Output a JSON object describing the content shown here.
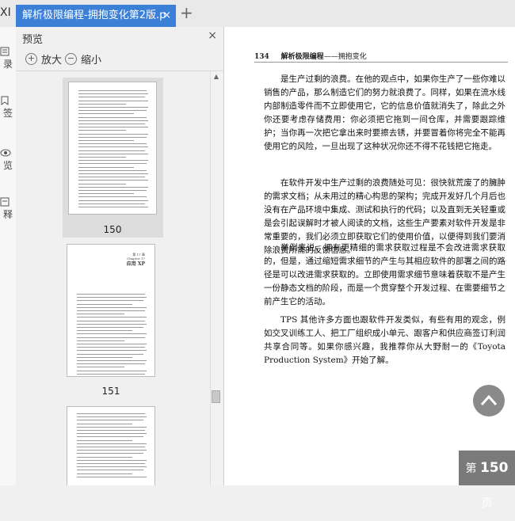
{
  "tabbar": {
    "left_fragment": "XI",
    "active_tab_title": "解析极限编程-拥抱变化第2版.p",
    "close_glyph": "×",
    "new_tab_glyph": "+"
  },
  "left_nav": {
    "items": [
      {
        "label": "录",
        "icon": "list-icon"
      },
      {
        "label": "签",
        "icon": "bookmark-icon"
      },
      {
        "label": "览",
        "icon": "eye-icon"
      },
      {
        "label": "释",
        "icon": "annotation-icon"
      }
    ]
  },
  "preview_panel": {
    "title": "预览",
    "close_glyph": "×",
    "zoom_in_label": "放大",
    "zoom_out_label": "缩小",
    "thumbnails": [
      {
        "page": "150",
        "selected": true
      },
      {
        "page": "151",
        "selected": false
      }
    ],
    "chapter_label_top": "第 17 章",
    "chapter_label_sub": "Chapter 17",
    "chapter_title": "应用 XP"
  },
  "document": {
    "page_number": "134",
    "header_title": "解析极限编程",
    "header_subtitle": "——拥抱变化",
    "paragraphs": [
      "是生产过剩的浪费。在他的观点中，如果你生产了一些你难以销售的产品，那么制造它们的努力就浪费了。同样，如果在流水线内部制造零件而不立即使用它，它的信息价值就消失了，除此之外你还要考虑存储费用：你必须把它拖到一间仓库，并需要跟踪维护；当你再一次把它拿出来时要擦去锈，并要冒着你将完全不能再使用它的风险，一旦出现了这种状况你还不得不花钱把它拖走。",
      "在软件开发中生产过剩的浪费随处可见：很快就荒废了的臃肿的需求文档；从未用过的精心构思的架构；完成开发好几个月后也没有在产品环境中集成、测试和执行的代码；以及直到无关轻重或是会引起误解时才被人阅读的文档，这些生产要素对软件开发是非常重要的，我们必须立即获取它们的使用价值，以便得到我们要消除浪费所需的反馈信息。",
      "举例来说，拥有更精细的需求获取过程是不会改进需求获取的，但是，通过缩短需求细节的产生与其相应软件的部署之间的路径是可以改进需求获取的。立即使用需求细节意味着获取不是产生一份静态文档的阶段，而是一个贯穿整个开发过程、在需要细节之前产生它的活动。",
      "TPS 其他许多方面也跟软件开发类似，有些有用的观念，例如交叉训练工人、把工厂组织成小单元、跟客户和供应商签订利润共享合同等。如果你感兴趣，我推荐你从大野耐一的《Toyota Production System》开始了解。"
    ]
  },
  "page_badge": {
    "prefix": "第",
    "number": "150",
    "suffix": "页"
  }
}
